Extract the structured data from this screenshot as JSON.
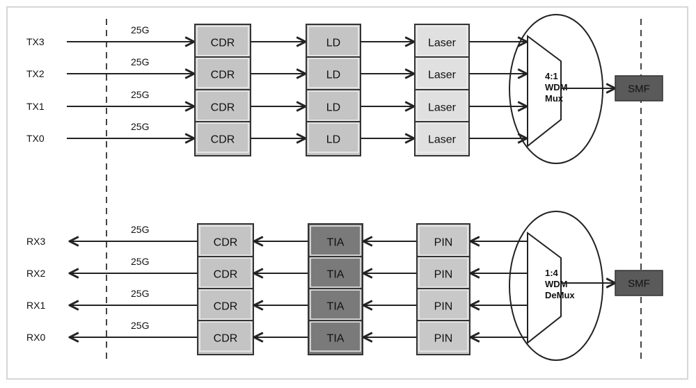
{
  "diagram": {
    "title": "",
    "tx": {
      "lanes": [
        {
          "label": "TX3",
          "rate": "25G"
        },
        {
          "label": "TX2",
          "rate": "25G"
        },
        {
          "label": "TX1",
          "rate": "25G"
        },
        {
          "label": "TX0",
          "rate": "25G"
        }
      ],
      "stages": [
        {
          "name": "CDR",
          "labels": [
            "CDR",
            "CDR",
            "CDR",
            "CDR"
          ],
          "fill": "#c4c4c4"
        },
        {
          "name": "LD",
          "labels": [
            "LD",
            "LD",
            "LD",
            "LD"
          ],
          "fill": "#c4c4c4"
        },
        {
          "name": "Laser",
          "labels": [
            "Laser",
            "Laser",
            "Laser",
            "Laser"
          ],
          "fill": "#e0e0e0"
        }
      ],
      "wdm": {
        "lines": [
          "4:1",
          "WDM",
          "Mux"
        ]
      },
      "fiber": {
        "label": "SMF",
        "fill": "#5a5a5a"
      },
      "direction": "left-to-right"
    },
    "rx": {
      "lanes": [
        {
          "label": "RX3",
          "rate": "25G"
        },
        {
          "label": "RX2",
          "rate": "25G"
        },
        {
          "label": "RX1",
          "rate": "25G"
        },
        {
          "label": "RX0",
          "rate": "25G"
        }
      ],
      "stages": [
        {
          "name": "CDR",
          "labels": [
            "CDR",
            "CDR",
            "CDR",
            "CDR"
          ],
          "fill": "#c4c4c4"
        },
        {
          "name": "TIA",
          "labels": [
            "TIA",
            "TIA",
            "TIA",
            "TIA"
          ],
          "fill": "#7a7a7a"
        },
        {
          "name": "PIN",
          "labels": [
            "PIN",
            "PIN",
            "PIN",
            "PIN"
          ],
          "fill": "#c8c8c8"
        }
      ],
      "wdm": {
        "lines": [
          "1:4",
          "WDM",
          "DeMux"
        ]
      },
      "fiber": {
        "label": "SMF",
        "fill": "#5a5a5a"
      },
      "direction": "right-to-left"
    },
    "colors": {
      "line": "#222222",
      "block_border": "#333333",
      "dashed_boundary": "#444444"
    }
  }
}
